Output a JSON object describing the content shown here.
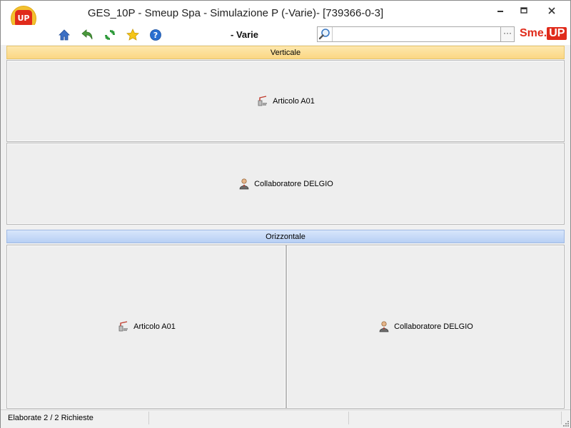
{
  "window": {
    "title": "GES_10P - Smeup Spa - Simulazione P (-Varie)- [739366-0-3]",
    "app_logo_text": "UP",
    "controls": {
      "minimize": "—",
      "restore": "▫",
      "close": "✕"
    }
  },
  "toolbar": {
    "section_label": "- Varie",
    "search": {
      "value": "",
      "placeholder": ""
    },
    "more_label": "···",
    "brand": {
      "left": "Sme.",
      "right": "UP"
    },
    "icons": [
      "home-icon",
      "back-icon",
      "refresh-icon",
      "favorite-star-icon",
      "help-icon"
    ]
  },
  "vertical_group": {
    "header": "Verticale",
    "items": [
      {
        "label": "Articolo A01",
        "icon": "article-icon"
      },
      {
        "label": "Collaboratore DELGIO",
        "icon": "person-icon"
      }
    ]
  },
  "horizontal_group": {
    "header": "Orizzontale",
    "items": [
      {
        "label": "Articolo A01",
        "icon": "article-icon"
      },
      {
        "label": "Collaboratore DELGIO",
        "icon": "person-icon"
      }
    ]
  },
  "status": {
    "text": "Elaborate 2 / 2 Richieste",
    "cell2": "",
    "cell3": ""
  },
  "colors": {
    "accent_red": "#e02b1b",
    "header_yellow": "#fbd784",
    "header_blue": "#b7cff4"
  }
}
